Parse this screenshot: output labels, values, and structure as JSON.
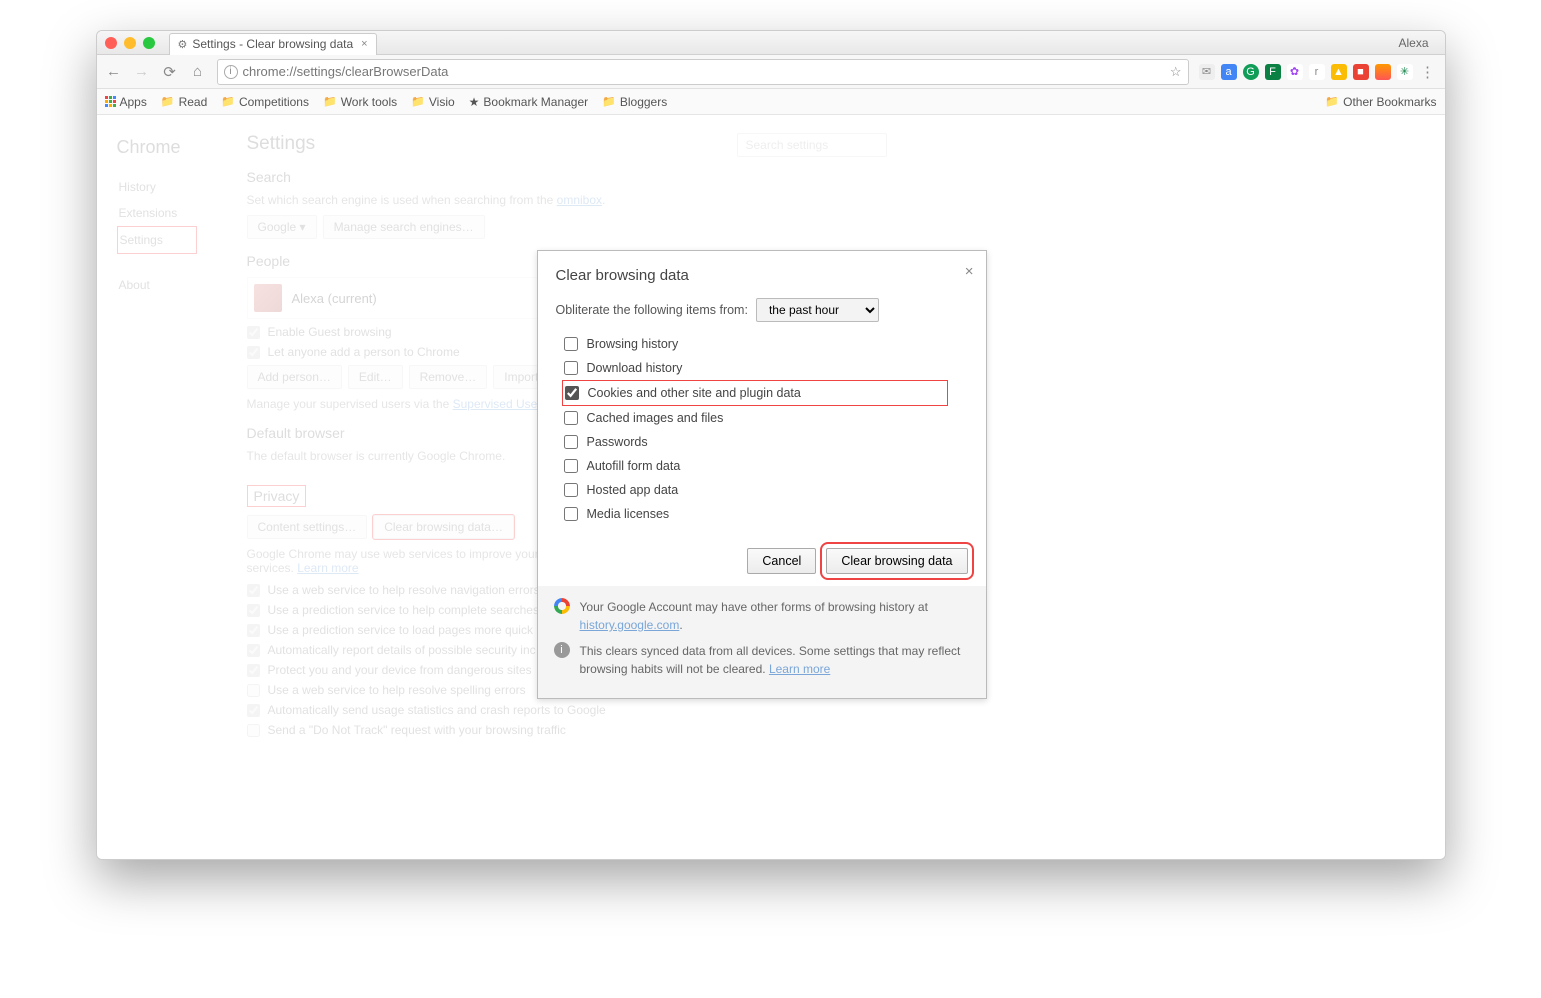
{
  "window": {
    "tab_title": "Settings - Clear browsing data",
    "profile": "Alexa",
    "url": "chrome://settings/clearBrowserData"
  },
  "bookmarks": {
    "apps": "Apps",
    "folders": [
      "Read",
      "Competitions",
      "Work tools",
      "Visio"
    ],
    "manager": "Bookmark Manager",
    "bloggers": "Bloggers",
    "other": "Other Bookmarks"
  },
  "sidenav": {
    "brand": "Chrome",
    "history": "History",
    "extensions": "Extensions",
    "settings": "Settings",
    "about": "About"
  },
  "settings": {
    "title": "Settings",
    "search_placeholder": "Search settings",
    "search_h": "Search",
    "search_desc_a": "Set which search engine is used when searching from the ",
    "search_desc_link": "omnibox",
    "search_desc_b": ".",
    "engine": "Google",
    "manage_engines": "Manage search engines…",
    "people_h": "People",
    "person": "Alexa (current)",
    "guest": "Enable Guest browsing",
    "anyone": "Let anyone add a person to Chrome",
    "add_person": "Add person…",
    "edit": "Edit…",
    "remove": "Remove…",
    "import": "Import",
    "supervised_a": "Manage your supervised users via the ",
    "supervised_link": "Supervised Use",
    "default_h": "Default browser",
    "default_desc": "The default browser is currently Google Chrome.",
    "privacy_h": "Privacy",
    "content_settings": "Content settings…",
    "clear_data_btn": "Clear browsing data…",
    "privacy_desc_a": "Google Chrome may use web services to improve your",
    "privacy_desc_b": "services. ",
    "learn_more": "Learn more",
    "privacy_opts": [
      "Use a web service to help resolve navigation errors",
      "Use a prediction service to help complete searches",
      "Use a prediction service to load pages more quick",
      "Automatically report details of possible security inc",
      "Protect you and your device from dangerous sites",
      "Use a web service to help resolve spelling errors",
      "Automatically send usage statistics and crash reports to Google",
      "Send a \"Do Not Track\" request with your browsing traffic"
    ],
    "privacy_checked": [
      true,
      true,
      true,
      true,
      true,
      false,
      true,
      false
    ]
  },
  "dialog": {
    "title": "Clear browsing data",
    "obliterate": "Obliterate the following items from:",
    "range": "the past hour",
    "items": [
      {
        "label": "Browsing history",
        "checked": false
      },
      {
        "label": "Download history",
        "checked": false
      },
      {
        "label": "Cookies and other site and plugin data",
        "checked": true,
        "boxed": true
      },
      {
        "label": "Cached images and files",
        "checked": false
      },
      {
        "label": "Passwords",
        "checked": false
      },
      {
        "label": "Autofill form data",
        "checked": false
      },
      {
        "label": "Hosted app data",
        "checked": false
      },
      {
        "label": "Media licenses",
        "checked": false
      }
    ],
    "cancel": "Cancel",
    "clear": "Clear browsing data",
    "footer1_a": "Your Google Account may have other forms of browsing history at ",
    "footer1_link": "history.google.com",
    "footer1_b": ".",
    "footer2_a": "This clears synced data from all devices. Some settings that may reflect browsing habits will not be cleared. ",
    "footer2_link": "Learn more"
  },
  "ext_colors": [
    "#efefef",
    "#4285f4",
    "#0f9d58",
    "#0f9d58",
    "#a142f4",
    "#888",
    "#fbbc05",
    "#ea4335",
    "#f90",
    "#0b8043"
  ]
}
